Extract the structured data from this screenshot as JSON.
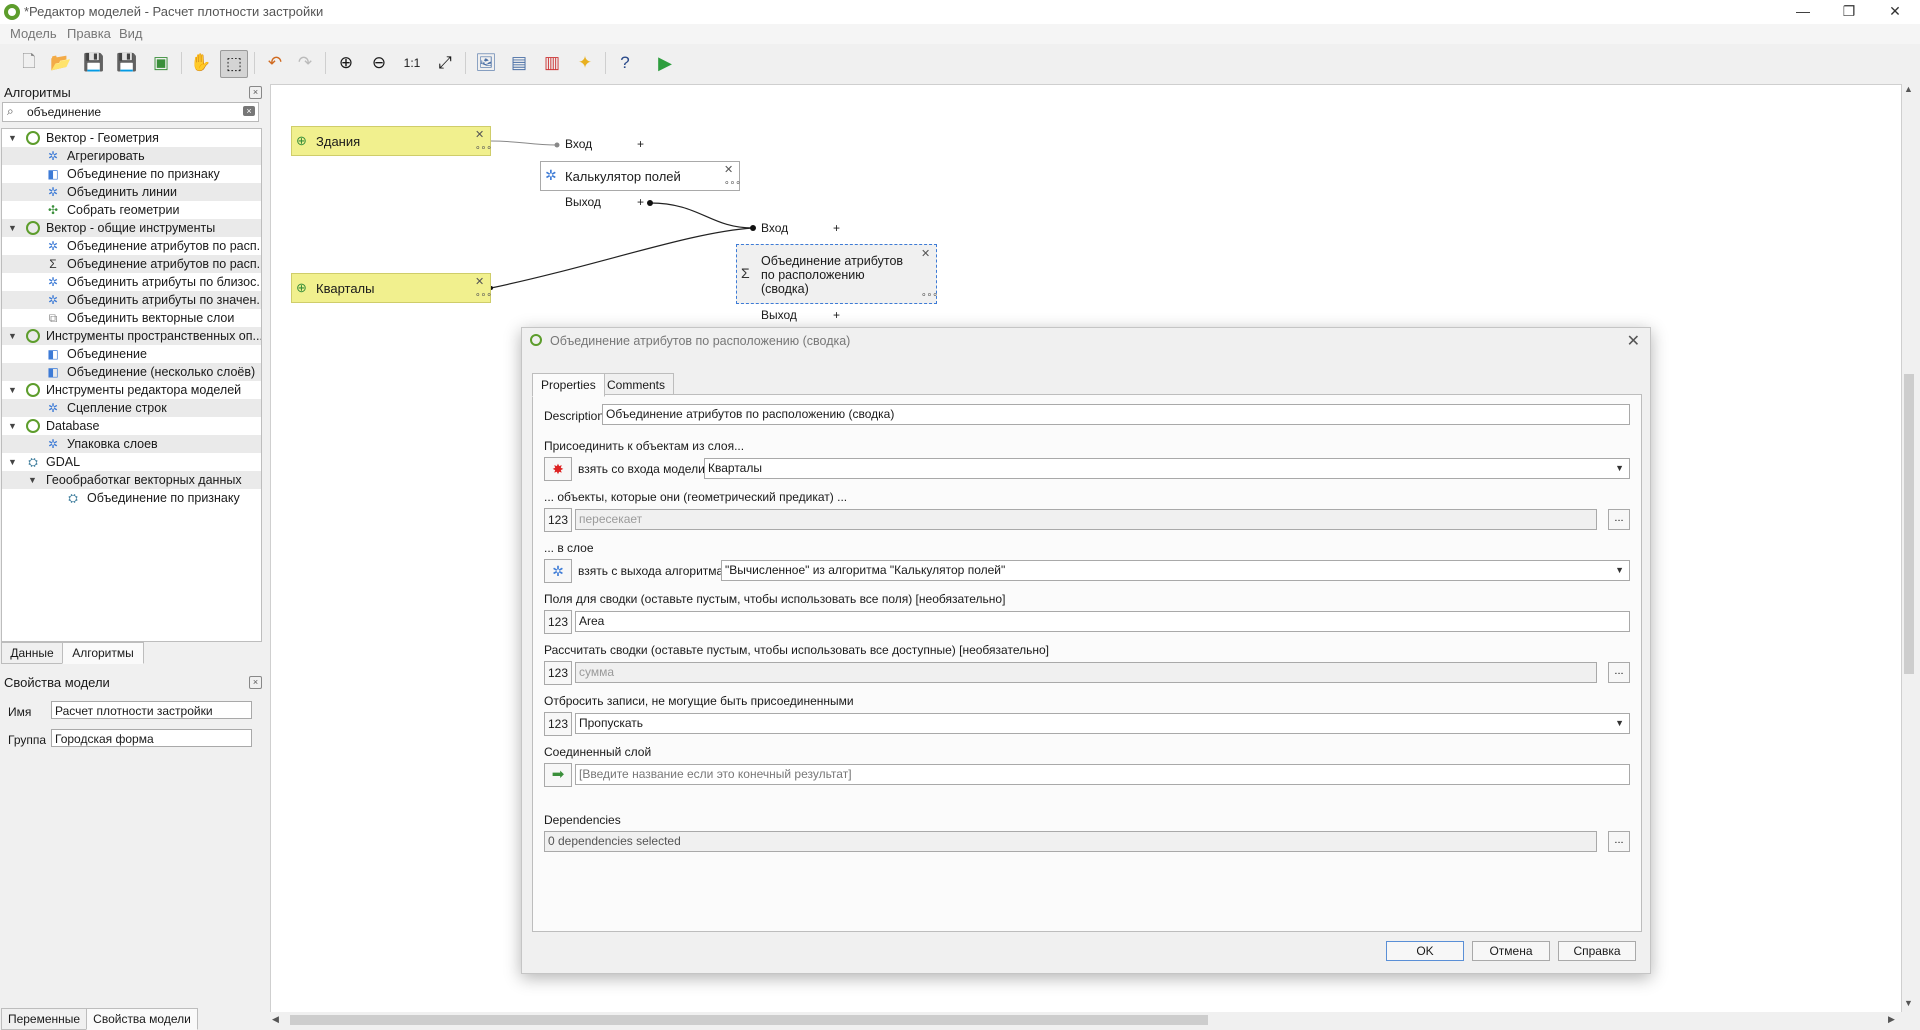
{
  "window": {
    "title": "*Редактор моделей - Расчет плотности застройки",
    "controls": [
      "—",
      "❐",
      "✕"
    ]
  },
  "menu": [
    "Модель",
    "Правка",
    "Вид"
  ],
  "left": {
    "algorithms_title": "Алгоритмы",
    "search_value": "объединение",
    "tree": [
      {
        "label": "Вектор - Геометрия",
        "level": 0
      },
      {
        "label": "Агрегировать",
        "level": 1
      },
      {
        "label": "Объединение по признаку",
        "level": 1
      },
      {
        "label": "Объединить линии",
        "level": 1
      },
      {
        "label": "Собрать геометрии",
        "level": 1
      },
      {
        "label": "Вектор - общие инструменты",
        "level": 0
      },
      {
        "label": "Объединение атрибутов по расп...",
        "level": 1
      },
      {
        "label": "Объединение атрибутов по расп...",
        "level": 1
      },
      {
        "label": "Объединить атрибуты по близос...",
        "level": 1
      },
      {
        "label": "Объединить атрибуты по значен...",
        "level": 1
      },
      {
        "label": "Объединить векторные слои",
        "level": 1
      },
      {
        "label": "Инструменты пространственных оп...",
        "level": 0
      },
      {
        "label": "Объединение",
        "level": 1
      },
      {
        "label": "Объединение (несколько слоёв)",
        "level": 1
      },
      {
        "label": "Инструменты редактора моделей",
        "level": 0
      },
      {
        "label": "Сцепление строк",
        "level": 1
      },
      {
        "label": "Database",
        "level": 0
      },
      {
        "label": "Упаковка слоев",
        "level": 1
      },
      {
        "label": "GDAL",
        "level": 0
      },
      {
        "label": "Геообработкаг векторных данных",
        "level": 1
      },
      {
        "label": "Объединение по признаку",
        "level": 2
      }
    ],
    "tabs": [
      "Данные",
      "Алгоритмы"
    ],
    "model_props_title": "Свойства модели",
    "name_label": "Имя",
    "name_value": "Расчет плотности застройки",
    "group_label": "Группа",
    "group_value": "Городская форма",
    "bottom_tabs": [
      "Переменные",
      "Свойства модели"
    ]
  },
  "canvas": {
    "input_buildings": "Здания",
    "input_blocks": "Кварталы",
    "calc_node": "Калькулятор полей",
    "join_node_lines": [
      "Объединение атрибутов",
      "по расположению",
      "(сводка)"
    ],
    "in_label": "Вход",
    "out_label": "Выход",
    "plus": "+"
  },
  "dialog": {
    "title": "Объединение атрибутов по расположению (сводка)",
    "tabs": [
      "Properties",
      "Comments"
    ],
    "description_label": "Description",
    "description_value": "Объединение атрибутов по расположению (сводка)",
    "join_label": "Присоединить к объектам из слоя...",
    "join_source": "взять со входа модели",
    "join_value": "Кварталы",
    "predicate_label": "... объекты, которые они (геометрический предикат) ...",
    "predicate_value": "пересекает",
    "layer_label": "... в слое",
    "layer_source": "взять с выхода алгоритма",
    "layer_value": "\"Вычисленное\" из алгоритма \"Калькулятор полей\"",
    "fields_label": "Поля для сводки (оставьте пустым, чтобы использовать все поля) [необязательно]",
    "fields_value": "Area",
    "summaries_label": "Рассчитать сводки (оставьте пустым, чтобы использовать все доступные) [необязательно]",
    "summaries_value": "сумма",
    "discard_label": "Отбросить записи, не могущие быть присоединенными",
    "discard_value": "Пропускать",
    "output_label": "Соединенный слой",
    "output_placeholder": "[Введите название если это конечный результат]",
    "dependencies_label": "Dependencies",
    "dependencies_value": "0 dependencies selected",
    "src_123": "123",
    "dots": "...",
    "ok": "OK",
    "cancel": "Отмена",
    "help": "Справка"
  }
}
